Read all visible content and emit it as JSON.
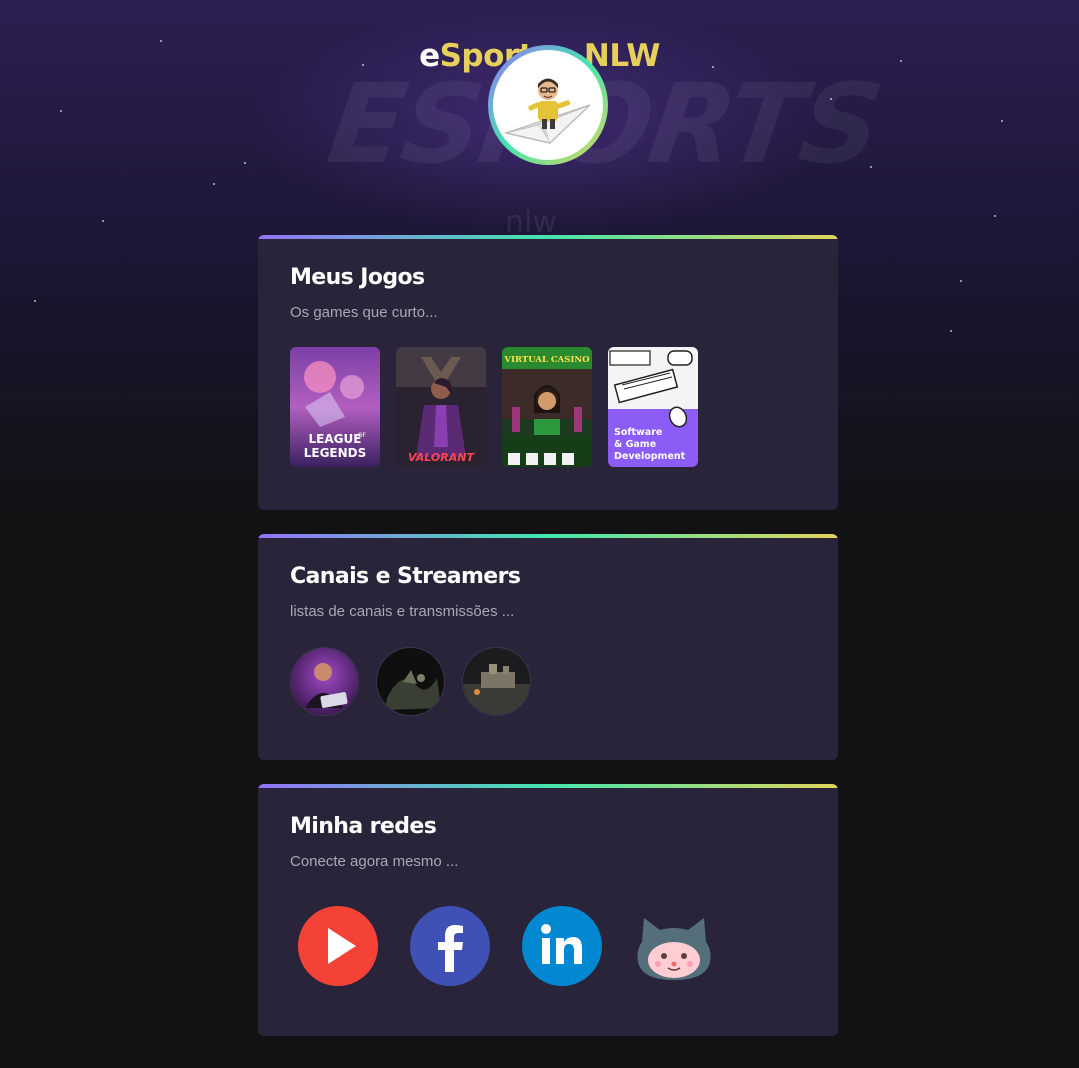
{
  "site": {
    "title_first_letter": "e",
    "title_rest": "Sports - NLW",
    "watermark": "ESPORTS",
    "watermark_sub": "nlw"
  },
  "games_section": {
    "title": "Meus Jogos",
    "subtitle": "Os games que curto...",
    "items": [
      {
        "name": "League of Legends",
        "cover_text_1": "LEAGUE",
        "cover_text_2": "OF",
        "cover_text_3": "LEGENDS"
      },
      {
        "name": "Valorant",
        "cover_text": "VALORANT"
      },
      {
        "name": "Virtual Casino",
        "cover_text": "VIRTUAL CASINO"
      },
      {
        "name": "Software & Game Development",
        "cover_text_1": "Software",
        "cover_text_2": "& Game",
        "cover_text_3": "Development"
      }
    ]
  },
  "streamers_section": {
    "title": "Canais e Streamers",
    "subtitle": "listas de canais e transmissões ..."
  },
  "socials_section": {
    "title": "Minha redes",
    "subtitle": "Conecte agora mesmo ...",
    "items": [
      {
        "name": "youtube",
        "icon": "youtube-icon",
        "color": "#f44336"
      },
      {
        "name": "facebook",
        "icon": "facebook-icon",
        "color": "#3f51b5"
      },
      {
        "name": "linkedin",
        "icon": "linkedin-icon",
        "color": "#0288d1"
      },
      {
        "name": "github",
        "icon": "github-icon",
        "color": "#546e7a"
      }
    ]
  },
  "colors": {
    "accent_gradient": [
      "#9572fc",
      "#43e7ad",
      "#e2d45c"
    ],
    "title_yellow": "#e6cf5a",
    "card_bg": "#29243a",
    "page_bg": "#121214"
  }
}
